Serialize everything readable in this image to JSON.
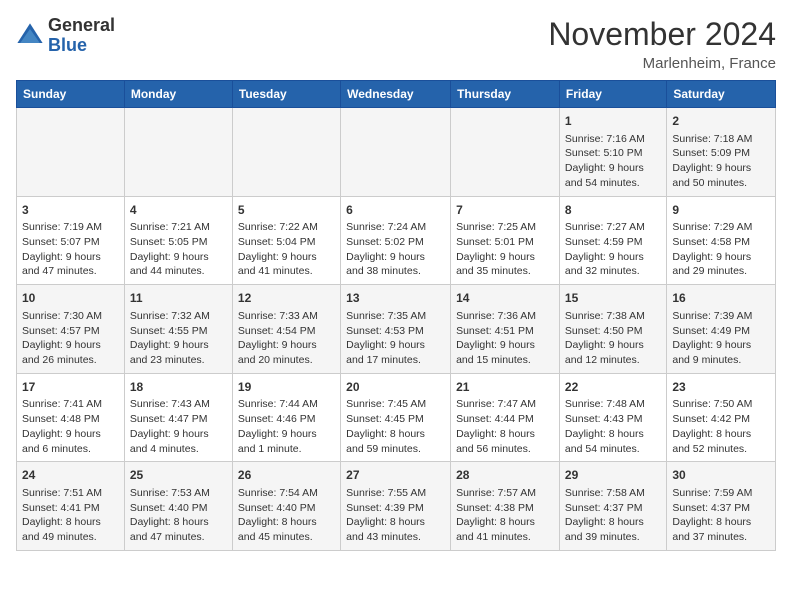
{
  "logo": {
    "general": "General",
    "blue": "Blue"
  },
  "header": {
    "month": "November 2024",
    "location": "Marlenheim, France"
  },
  "days_of_week": [
    "Sunday",
    "Monday",
    "Tuesday",
    "Wednesday",
    "Thursday",
    "Friday",
    "Saturday"
  ],
  "weeks": [
    [
      {
        "day": "",
        "info": ""
      },
      {
        "day": "",
        "info": ""
      },
      {
        "day": "",
        "info": ""
      },
      {
        "day": "",
        "info": ""
      },
      {
        "day": "",
        "info": ""
      },
      {
        "day": "1",
        "info": "Sunrise: 7:16 AM\nSunset: 5:10 PM\nDaylight: 9 hours and 54 minutes."
      },
      {
        "day": "2",
        "info": "Sunrise: 7:18 AM\nSunset: 5:09 PM\nDaylight: 9 hours and 50 minutes."
      }
    ],
    [
      {
        "day": "3",
        "info": "Sunrise: 7:19 AM\nSunset: 5:07 PM\nDaylight: 9 hours and 47 minutes."
      },
      {
        "day": "4",
        "info": "Sunrise: 7:21 AM\nSunset: 5:05 PM\nDaylight: 9 hours and 44 minutes."
      },
      {
        "day": "5",
        "info": "Sunrise: 7:22 AM\nSunset: 5:04 PM\nDaylight: 9 hours and 41 minutes."
      },
      {
        "day": "6",
        "info": "Sunrise: 7:24 AM\nSunset: 5:02 PM\nDaylight: 9 hours and 38 minutes."
      },
      {
        "day": "7",
        "info": "Sunrise: 7:25 AM\nSunset: 5:01 PM\nDaylight: 9 hours and 35 minutes."
      },
      {
        "day": "8",
        "info": "Sunrise: 7:27 AM\nSunset: 4:59 PM\nDaylight: 9 hours and 32 minutes."
      },
      {
        "day": "9",
        "info": "Sunrise: 7:29 AM\nSunset: 4:58 PM\nDaylight: 9 hours and 29 minutes."
      }
    ],
    [
      {
        "day": "10",
        "info": "Sunrise: 7:30 AM\nSunset: 4:57 PM\nDaylight: 9 hours and 26 minutes."
      },
      {
        "day": "11",
        "info": "Sunrise: 7:32 AM\nSunset: 4:55 PM\nDaylight: 9 hours and 23 minutes."
      },
      {
        "day": "12",
        "info": "Sunrise: 7:33 AM\nSunset: 4:54 PM\nDaylight: 9 hours and 20 minutes."
      },
      {
        "day": "13",
        "info": "Sunrise: 7:35 AM\nSunset: 4:53 PM\nDaylight: 9 hours and 17 minutes."
      },
      {
        "day": "14",
        "info": "Sunrise: 7:36 AM\nSunset: 4:51 PM\nDaylight: 9 hours and 15 minutes."
      },
      {
        "day": "15",
        "info": "Sunrise: 7:38 AM\nSunset: 4:50 PM\nDaylight: 9 hours and 12 minutes."
      },
      {
        "day": "16",
        "info": "Sunrise: 7:39 AM\nSunset: 4:49 PM\nDaylight: 9 hours and 9 minutes."
      }
    ],
    [
      {
        "day": "17",
        "info": "Sunrise: 7:41 AM\nSunset: 4:48 PM\nDaylight: 9 hours and 6 minutes."
      },
      {
        "day": "18",
        "info": "Sunrise: 7:43 AM\nSunset: 4:47 PM\nDaylight: 9 hours and 4 minutes."
      },
      {
        "day": "19",
        "info": "Sunrise: 7:44 AM\nSunset: 4:46 PM\nDaylight: 9 hours and 1 minute."
      },
      {
        "day": "20",
        "info": "Sunrise: 7:45 AM\nSunset: 4:45 PM\nDaylight: 8 hours and 59 minutes."
      },
      {
        "day": "21",
        "info": "Sunrise: 7:47 AM\nSunset: 4:44 PM\nDaylight: 8 hours and 56 minutes."
      },
      {
        "day": "22",
        "info": "Sunrise: 7:48 AM\nSunset: 4:43 PM\nDaylight: 8 hours and 54 minutes."
      },
      {
        "day": "23",
        "info": "Sunrise: 7:50 AM\nSunset: 4:42 PM\nDaylight: 8 hours and 52 minutes."
      }
    ],
    [
      {
        "day": "24",
        "info": "Sunrise: 7:51 AM\nSunset: 4:41 PM\nDaylight: 8 hours and 49 minutes."
      },
      {
        "day": "25",
        "info": "Sunrise: 7:53 AM\nSunset: 4:40 PM\nDaylight: 8 hours and 47 minutes."
      },
      {
        "day": "26",
        "info": "Sunrise: 7:54 AM\nSunset: 4:40 PM\nDaylight: 8 hours and 45 minutes."
      },
      {
        "day": "27",
        "info": "Sunrise: 7:55 AM\nSunset: 4:39 PM\nDaylight: 8 hours and 43 minutes."
      },
      {
        "day": "28",
        "info": "Sunrise: 7:57 AM\nSunset: 4:38 PM\nDaylight: 8 hours and 41 minutes."
      },
      {
        "day": "29",
        "info": "Sunrise: 7:58 AM\nSunset: 4:37 PM\nDaylight: 8 hours and 39 minutes."
      },
      {
        "day": "30",
        "info": "Sunrise: 7:59 AM\nSunset: 4:37 PM\nDaylight: 8 hours and 37 minutes."
      }
    ]
  ]
}
